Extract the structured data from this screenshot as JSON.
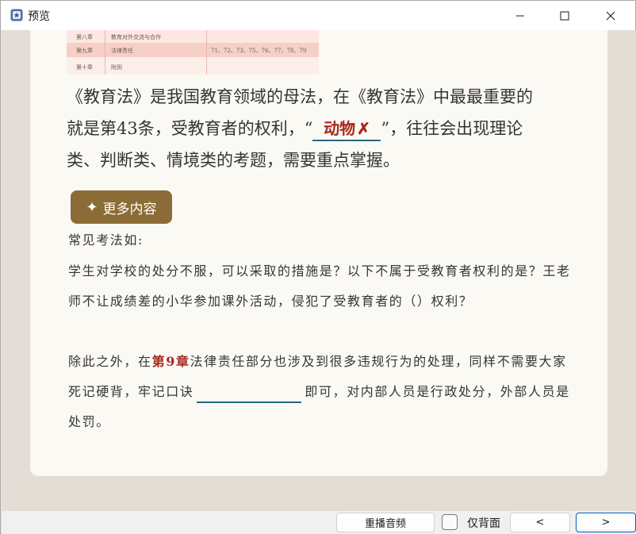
{
  "window": {
    "title": "预览"
  },
  "table": {
    "rows": [
      {
        "chapter": "第八章",
        "name": "教育对外交流与合作",
        "items": ""
      },
      {
        "chapter": "第九章",
        "name": "法律责任",
        "items": "71、72、73、75、76、77、78、79"
      },
      {
        "chapter": "第十章",
        "name": "附则",
        "items": ""
      }
    ]
  },
  "main": {
    "line1": "《教育法》是我国教育领域的母法，在《教育法》中最最重要的",
    "line2_before": "就是第43条，受教育者的权利，“",
    "answer_text": "动物",
    "answer_mark": "✗",
    "line2_after": "”，往往会出现理论",
    "line3": "类、判断类、情境类的考题，需要重点掌握。"
  },
  "more_button": {
    "icon": "✦",
    "label": "更多内容"
  },
  "sections": {
    "common_title": "常见考法如:",
    "questions": "学生对学校的处分不服，可以采取的措施是？以下不属于受教育者权利的是？王老师不让成绩差的小华参加课外活动，侵犯了受教育者的（）权利？",
    "p3_before": "除此之外，在",
    "p3_highlight": "第9章",
    "p3_middle": "法律责任部分也涉及到很多违规行为的处理，同样不需要大家死记硬背，牢记口诀",
    "p3_after": "即可，对内部人员是行政处分，外部人员是处罚。"
  },
  "bottom": {
    "replay_label": "重播音频",
    "back_only_label": "仅背面",
    "back_only_checked": false,
    "prev_label": "<",
    "next_label": ">"
  },
  "colors": {
    "accent_red": "#a5281e",
    "button_brown": "#8c6c36",
    "underline_blue": "#2a6683"
  }
}
